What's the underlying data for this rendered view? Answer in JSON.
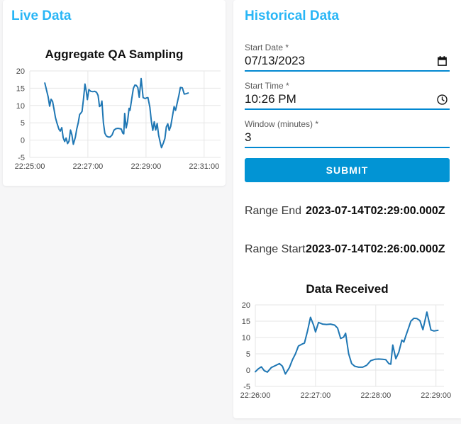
{
  "colors": {
    "page_bg": "#f6f6f7",
    "card_bg": "#ffffff",
    "heading_accent": "#29b6f6",
    "field_underline": "#0288d1",
    "submit_bg": "#0294d4",
    "submit_text": "#ffffff",
    "chart_line": "#1f77b4",
    "grid_line": "#e6e6e6",
    "tick_text": "#454545"
  },
  "live": {
    "heading": "Live Data"
  },
  "historical": {
    "heading": "Historical Data",
    "fields": [
      {
        "label": "Start Date *",
        "value": "07/13/2023",
        "icon": "calendar-icon"
      },
      {
        "label": "Start Time *",
        "value": "10:26 PM",
        "icon": "clock-icon"
      },
      {
        "label": "Window (minutes) *",
        "value": "3",
        "icon": ""
      }
    ],
    "submit_label": "SUBMIT",
    "results": [
      {
        "label": "Range End",
        "value": "2023-07-14T02:29:00.000Z"
      },
      {
        "label": "Range Start",
        "value": "2023-07-14T02:26:00.000Z"
      }
    ]
  },
  "chart_data": [
    {
      "type": "line",
      "title": "Aggregate QA Sampling",
      "xlabel": "",
      "ylabel": "",
      "grid": true,
      "legend": false,
      "line_color": "#1f77b4",
      "ylim": [
        -5,
        20
      ],
      "y_ticks": [
        20,
        15,
        10,
        5,
        0,
        -5
      ],
      "x_tick_labels": [
        "22:25:00",
        "22:27:00",
        "22:29:00",
        "22:31:00"
      ],
      "x_tick_t": [
        0,
        120,
        240,
        360
      ],
      "t_max": 394,
      "x_unit": "seconds after 22:25:00",
      "points": [
        [
          31,
          16.5
        ],
        [
          34,
          14.8
        ],
        [
          38,
          12.5
        ],
        [
          41,
          9.8
        ],
        [
          44,
          11.8
        ],
        [
          47,
          11.2
        ],
        [
          50,
          9.0
        ],
        [
          53,
          6.5
        ],
        [
          56,
          5.0
        ],
        [
          60,
          3.2
        ],
        [
          63,
          2.6
        ],
        [
          66,
          3.6
        ],
        [
          69,
          0.7
        ],
        [
          72,
          -0.4
        ],
        [
          75,
          0.6
        ],
        [
          78,
          -1.0
        ],
        [
          81,
          -0.3
        ],
        [
          84,
          2.9
        ],
        [
          87,
          1.5
        ],
        [
          90,
          -1.2
        ],
        [
          94,
          0.8
        ],
        [
          97,
          3.2
        ],
        [
          100,
          5.0
        ],
        [
          103,
          7.4
        ],
        [
          106,
          7.9
        ],
        [
          108,
          8.3
        ],
        [
          111,
          12.0
        ],
        [
          114,
          16.2
        ],
        [
          117,
          13.8
        ],
        [
          119,
          11.7
        ],
        [
          122,
          14.6
        ],
        [
          126,
          14.1
        ],
        [
          130,
          14.0
        ],
        [
          134,
          14.1
        ],
        [
          138,
          13.8
        ],
        [
          141,
          12.9
        ],
        [
          144,
          9.7
        ],
        [
          147,
          10.1
        ],
        [
          149,
          11.3
        ],
        [
          152,
          5.0
        ],
        [
          155,
          2.0
        ],
        [
          158,
          1.2
        ],
        [
          162,
          0.9
        ],
        [
          166,
          0.9
        ],
        [
          170,
          1.5
        ],
        [
          174,
          2.9
        ],
        [
          178,
          3.3
        ],
        [
          182,
          3.4
        ],
        [
          186,
          3.3
        ],
        [
          189,
          3.2
        ],
        [
          192,
          2.0
        ],
        [
          194,
          1.8
        ],
        [
          196,
          7.7
        ],
        [
          199,
          3.5
        ],
        [
          202,
          5.5
        ],
        [
          205,
          9.2
        ],
        [
          207,
          8.6
        ],
        [
          209,
          10.5
        ],
        [
          212,
          13.2
        ],
        [
          214,
          15.0
        ],
        [
          217,
          15.9
        ],
        [
          220,
          15.8
        ],
        [
          223,
          15.2
        ],
        [
          226,
          12.4
        ],
        [
          230,
          17.8
        ],
        [
          234,
          12.3
        ],
        [
          238,
          12.0
        ],
        [
          241,
          12.2
        ],
        [
          244,
          12.3
        ],
        [
          248,
          9.5
        ],
        [
          251,
          5.5
        ],
        [
          254,
          2.8
        ],
        [
          257,
          5.3
        ],
        [
          260,
          2.9
        ],
        [
          263,
          4.8
        ],
        [
          266,
          1.5
        ],
        [
          269,
          -0.5
        ],
        [
          272,
          -2.2
        ],
        [
          276,
          -0.8
        ],
        [
          279,
          0.5
        ],
        [
          282,
          3.8
        ],
        [
          285,
          4.7
        ],
        [
          288,
          2.8
        ],
        [
          291,
          4.0
        ],
        [
          295,
          7.2
        ],
        [
          298,
          9.7
        ],
        [
          301,
          8.6
        ],
        [
          304,
          10.5
        ],
        [
          308,
          13.0
        ],
        [
          311,
          15.2
        ],
        [
          315,
          15.1
        ],
        [
          319,
          13.3
        ],
        [
          323,
          13.4
        ],
        [
          327,
          13.6
        ]
      ]
    },
    {
      "type": "line",
      "title": "Data Received",
      "xlabel": "",
      "ylabel": "",
      "grid": true,
      "legend": false,
      "line_color": "#1f77b4",
      "ylim": [
        -5,
        20
      ],
      "y_ticks": [
        20,
        15,
        10,
        5,
        0,
        -5
      ],
      "x_tick_labels": [
        "22:26:00",
        "22:27:00",
        "22:28:00",
        "22:29:00"
      ],
      "x_tick_t": [
        0,
        60,
        120,
        180
      ],
      "t_max": 188,
      "x_unit": "seconds after 22:26:00",
      "points": [
        [
          0,
          -0.5
        ],
        [
          3,
          0.4
        ],
        [
          6,
          1.0
        ],
        [
          9,
          -0.2
        ],
        [
          12,
          -0.6
        ],
        [
          16,
          0.8
        ],
        [
          20,
          1.4
        ],
        [
          24,
          2.0
        ],
        [
          27,
          1.2
        ],
        [
          30,
          -1.2
        ],
        [
          34,
          0.8
        ],
        [
          37,
          3.2
        ],
        [
          40,
          5.0
        ],
        [
          43,
          7.4
        ],
        [
          46,
          7.9
        ],
        [
          49,
          8.3
        ],
        [
          52,
          12.0
        ],
        [
          55,
          16.2
        ],
        [
          58,
          13.8
        ],
        [
          60,
          11.7
        ],
        [
          63,
          14.6
        ],
        [
          67,
          14.1
        ],
        [
          71,
          14.0
        ],
        [
          75,
          14.1
        ],
        [
          79,
          13.8
        ],
        [
          82,
          12.9
        ],
        [
          85,
          9.7
        ],
        [
          88,
          10.1
        ],
        [
          90,
          11.3
        ],
        [
          93,
          5.0
        ],
        [
          96,
          2.0
        ],
        [
          99,
          1.2
        ],
        [
          103,
          0.9
        ],
        [
          107,
          0.9
        ],
        [
          111,
          1.5
        ],
        [
          115,
          2.9
        ],
        [
          119,
          3.3
        ],
        [
          123,
          3.4
        ],
        [
          127,
          3.3
        ],
        [
          130,
          3.2
        ],
        [
          133,
          2.0
        ],
        [
          135,
          1.8
        ],
        [
          137,
          7.7
        ],
        [
          140,
          3.5
        ],
        [
          143,
          5.5
        ],
        [
          146,
          9.2
        ],
        [
          148,
          8.6
        ],
        [
          150,
          10.5
        ],
        [
          153,
          13.2
        ],
        [
          155,
          15.0
        ],
        [
          158,
          15.9
        ],
        [
          161,
          15.8
        ],
        [
          164,
          15.2
        ],
        [
          167,
          12.4
        ],
        [
          171,
          17.8
        ],
        [
          175,
          12.3
        ],
        [
          178,
          12.0
        ],
        [
          182,
          12.2
        ]
      ]
    }
  ]
}
